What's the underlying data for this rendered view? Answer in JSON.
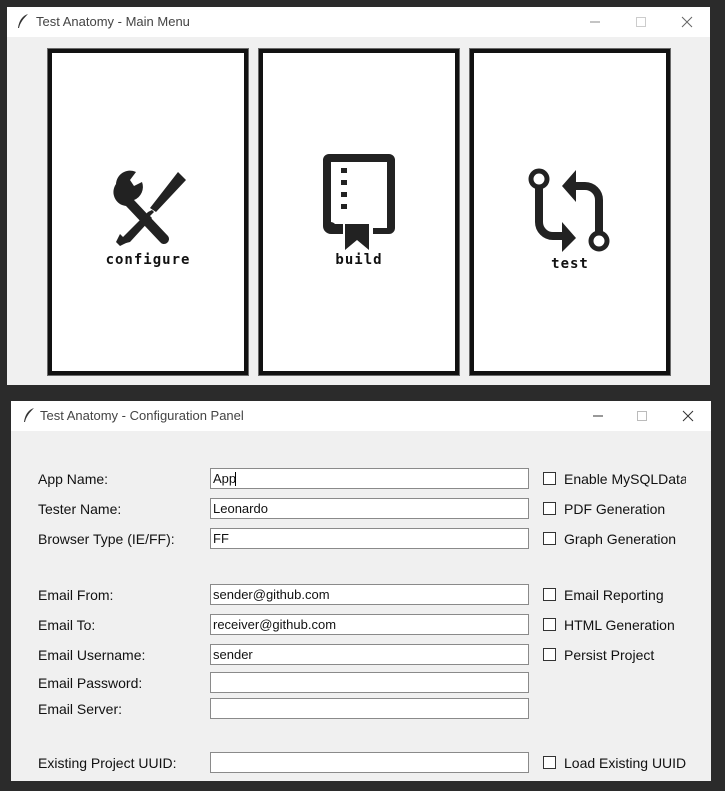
{
  "main_window": {
    "title": "Test Anatomy - Main Menu",
    "tiles": [
      {
        "label": "configure",
        "icon": "tools-icon"
      },
      {
        "label": "build",
        "icon": "book-icon"
      },
      {
        "label": "test",
        "icon": "pull-request-icon"
      }
    ]
  },
  "config_window": {
    "title": "Test Anatomy - Configuration Panel",
    "fields": {
      "app_name": {
        "label": "App Name:",
        "value": "App"
      },
      "tester_name": {
        "label": "Tester Name:",
        "value": "Leonardo"
      },
      "browser_type": {
        "label": "Browser Type (IE/FF):",
        "value": "FF"
      },
      "email_from": {
        "label": "Email From:",
        "value": "sender@github.com"
      },
      "email_to": {
        "label": "Email To:",
        "value": "receiver@github.com"
      },
      "email_username": {
        "label": "Email Username:",
        "value": "sender"
      },
      "email_password": {
        "label": "Email Password:",
        "value": ""
      },
      "email_server": {
        "label": "Email Server:",
        "value": ""
      },
      "project_uuid": {
        "label": "Existing Project UUID:",
        "value": ""
      }
    },
    "checkboxes": {
      "mysql": "Enable MySQLDataba",
      "pdf": "PDF Generation",
      "graph": "Graph Generation",
      "email_reporting": "Email Reporting",
      "html": "HTML Generation",
      "persist": "Persist Project",
      "load_uuid": "Load Existing UUID"
    }
  },
  "colors": {
    "window_bg": "#f0f0f0",
    "titlebar": "#ffffff",
    "desktop": "#2b2b2b",
    "tile_border": "#111111"
  }
}
